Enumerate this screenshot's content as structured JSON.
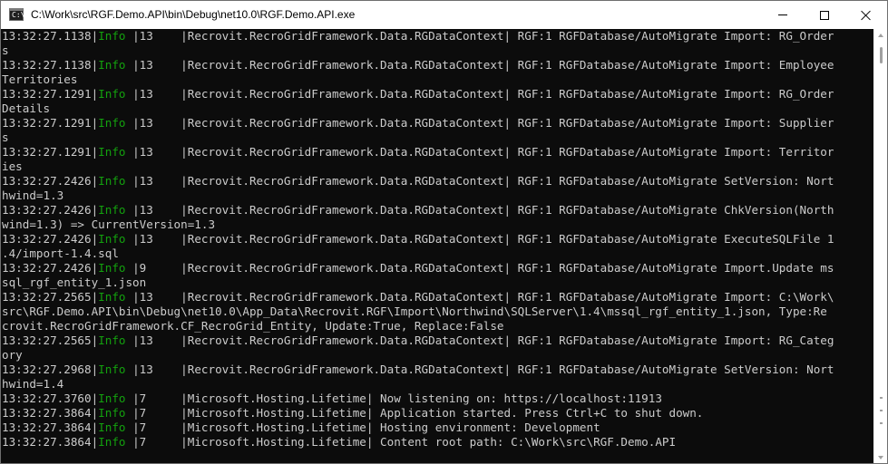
{
  "window": {
    "title": "C:\\Work\\src\\RGF.Demo.API\\bin\\Debug\\net10.0\\RGF.Demo.API.exe",
    "icon_text": "C:\\",
    "icon": "console-app-icon",
    "buttons": {
      "minimize": "minimize-icon",
      "maximize": "maximize-icon",
      "close": "close-icon"
    }
  },
  "colors": {
    "background": "#0c0c0c",
    "foreground": "#cccccc",
    "info": "#13a10e"
  },
  "console": {
    "lines": [
      {
        "pre": "13:32:27.1138|",
        "lvl": "Info",
        "post": " |13    |Recrovit.RecroGridFramework.Data.RGDataContext| RGF:1 RGFDatabase/AutoMigrate Import: RG_Order"
      },
      {
        "pre": "s",
        "lvl": "",
        "post": ""
      },
      {
        "pre": "13:32:27.1138|",
        "lvl": "Info",
        "post": " |13    |Recrovit.RecroGridFramework.Data.RGDataContext| RGF:1 RGFDatabase/AutoMigrate Import: Employee"
      },
      {
        "pre": "Territories",
        "lvl": "",
        "post": ""
      },
      {
        "pre": "13:32:27.1291|",
        "lvl": "Info",
        "post": " |13    |Recrovit.RecroGridFramework.Data.RGDataContext| RGF:1 RGFDatabase/AutoMigrate Import: RG_Order"
      },
      {
        "pre": "Details",
        "lvl": "",
        "post": ""
      },
      {
        "pre": "13:32:27.1291|",
        "lvl": "Info",
        "post": " |13    |Recrovit.RecroGridFramework.Data.RGDataContext| RGF:1 RGFDatabase/AutoMigrate Import: Supplier"
      },
      {
        "pre": "s",
        "lvl": "",
        "post": ""
      },
      {
        "pre": "13:32:27.1291|",
        "lvl": "Info",
        "post": " |13    |Recrovit.RecroGridFramework.Data.RGDataContext| RGF:1 RGFDatabase/AutoMigrate Import: Territor"
      },
      {
        "pre": "ies",
        "lvl": "",
        "post": ""
      },
      {
        "pre": "13:32:27.2426|",
        "lvl": "Info",
        "post": " |13    |Recrovit.RecroGridFramework.Data.RGDataContext| RGF:1 RGFDatabase/AutoMigrate SetVersion: Nort"
      },
      {
        "pre": "hwind=1.3",
        "lvl": "",
        "post": ""
      },
      {
        "pre": "13:32:27.2426|",
        "lvl": "Info",
        "post": " |13    |Recrovit.RecroGridFramework.Data.RGDataContext| RGF:1 RGFDatabase/AutoMigrate ChkVersion(North"
      },
      {
        "pre": "wind=1.3) => CurrentVersion=1.3",
        "lvl": "",
        "post": ""
      },
      {
        "pre": "13:32:27.2426|",
        "lvl": "Info",
        "post": " |13    |Recrovit.RecroGridFramework.Data.RGDataContext| RGF:1 RGFDatabase/AutoMigrate ExecuteSQLFile 1"
      },
      {
        "pre": ".4/import-1.4.sql",
        "lvl": "",
        "post": ""
      },
      {
        "pre": "13:32:27.2426|",
        "lvl": "Info",
        "post": " |9     |Recrovit.RecroGridFramework.Data.RGDataContext| RGF:1 RGFDatabase/AutoMigrate Import.Update ms"
      },
      {
        "pre": "sql_rgf_entity_1.json",
        "lvl": "",
        "post": ""
      },
      {
        "pre": "13:32:27.2565|",
        "lvl": "Info",
        "post": " |13    |Recrovit.RecroGridFramework.Data.RGDataContext| RGF:1 RGFDatabase/AutoMigrate Import: C:\\Work\\"
      },
      {
        "pre": "src\\RGF.Demo.API\\bin\\Debug\\net10.0\\App_Data\\Recrovit.RGF\\Import\\Northwind\\SQLServer\\1.4\\mssql_rgf_entity_1.json, Type:Re",
        "lvl": "",
        "post": ""
      },
      {
        "pre": "crovit.RecroGridFramework.CF_RecroGrid_Entity, Update:True, Replace:False",
        "lvl": "",
        "post": ""
      },
      {
        "pre": "13:32:27.2565|",
        "lvl": "Info",
        "post": " |13    |Recrovit.RecroGridFramework.Data.RGDataContext| RGF:1 RGFDatabase/AutoMigrate Import: RG_Categ"
      },
      {
        "pre": "ory",
        "lvl": "",
        "post": ""
      },
      {
        "pre": "13:32:27.2968|",
        "lvl": "Info",
        "post": " |13    |Recrovit.RecroGridFramework.Data.RGDataContext| RGF:1 RGFDatabase/AutoMigrate SetVersion: Nort"
      },
      {
        "pre": "hwind=1.4",
        "lvl": "",
        "post": ""
      },
      {
        "pre": "13:32:27.3760|",
        "lvl": "Info",
        "post": " |7     |Microsoft.Hosting.Lifetime| Now listening on: https://localhost:11913"
      },
      {
        "pre": "13:32:27.3864|",
        "lvl": "Info",
        "post": " |7     |Microsoft.Hosting.Lifetime| Application started. Press Ctrl+C to shut down."
      },
      {
        "pre": "13:32:27.3864|",
        "lvl": "Info",
        "post": " |7     |Microsoft.Hosting.Lifetime| Hosting environment: Development"
      },
      {
        "pre": "13:32:27.3864|",
        "lvl": "Info",
        "post": " |7     |Microsoft.Hosting.Lifetime| Content root path: C:\\Work\\src\\RGF.Demo.API"
      }
    ]
  }
}
